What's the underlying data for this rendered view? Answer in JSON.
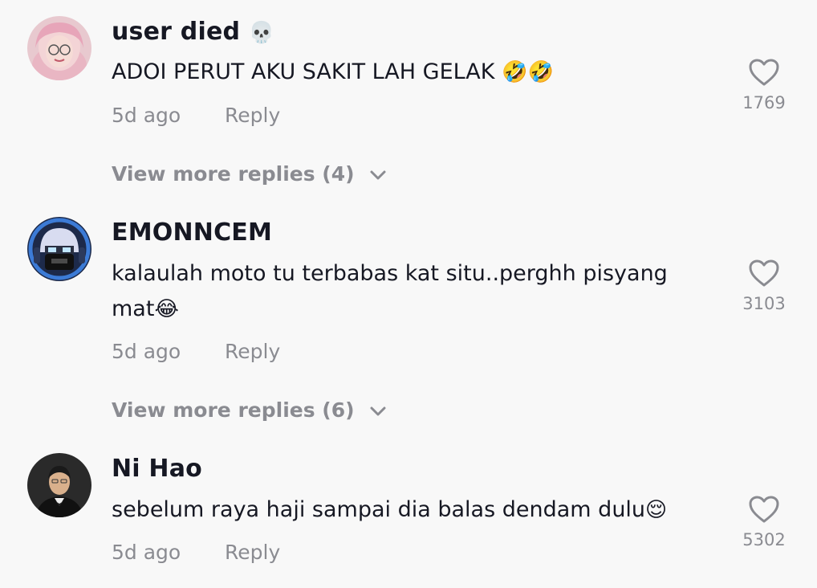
{
  "comments": [
    {
      "username": "user died",
      "username_emoji": "💀",
      "text": "ADOI PERUT AKU SAKIT LAH GELAK",
      "text_emoji": "🤣🤣",
      "time": "5d ago",
      "reply_label": "Reply",
      "likes": "1769",
      "view_more": "View more replies (4)",
      "avatar_icon": "avatar-girl-pink-hijab"
    },
    {
      "username": "EMONNCEM",
      "text": "kalaulah moto tu terbabas kat situ..perghh pisyang mat",
      "text_emoji": "😂",
      "time": "5d ago",
      "reply_label": "Reply",
      "likes": "3103",
      "view_more": "View more replies (6)",
      "avatar_icon": "avatar-masked-gamer"
    },
    {
      "username": "Ni Hao",
      "text": "sebelum raya haji sampai dia balas dendam dulu",
      "text_emoji": "😌",
      "time": "5d ago",
      "reply_label": "Reply",
      "likes": "5302",
      "avatar_icon": "avatar-man-tuxedo"
    }
  ],
  "colors": {
    "background": "#f8f8f8",
    "primary_text": "#161823",
    "secondary_text": "#8a8b91",
    "heart_outline": "#8a8b91"
  }
}
